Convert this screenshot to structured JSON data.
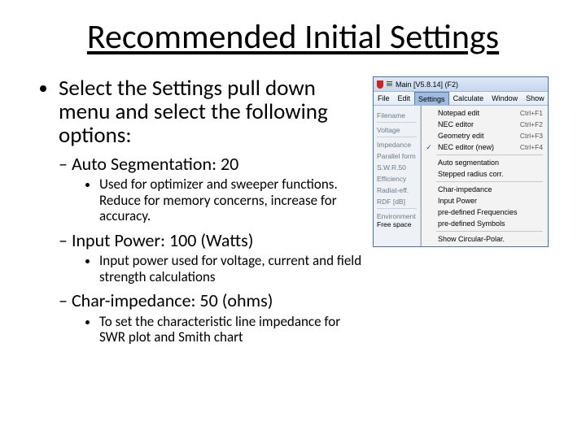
{
  "title": "Recommended Initial Settings",
  "bullet1": "Select the Settings pull down menu and select the following options:",
  "sub1": "Auto Segmentation: 20",
  "sub1_detail": "Used for optimizer and sweeper functions. Reduce for memory concerns, increase for accuracy.",
  "sub2": "Input Power: 100 (Watts)",
  "sub2_detail": "Input power used for voltage, current and field strength calculations",
  "sub3": "Char-impedance: 50 (ohms)",
  "sub3_detail": "To set the characteristic line impedance for SWR plot and Smith chart",
  "app": {
    "title": "Main [V5.8.14] (F2)",
    "menu": {
      "file": "File",
      "edit": "Edit",
      "settings": "Settings",
      "calculate": "Calculate",
      "window": "Window",
      "show": "Show"
    },
    "side": {
      "filename_hdr": "Filename",
      "filename_val": "",
      "voltage_hdr": "Voltage",
      "impedance_hdr": "Impedance",
      "parallel_hdr": "Parallel form",
      "swr_hdr": "S.W.R.50",
      "efficiency_hdr": "Efficiency",
      "radiat_hdr": "Radiat-eff.",
      "rdf_hdr": "RDF [dB]",
      "env_hdr": "Environment",
      "env_val": "Free space"
    },
    "dropdown": {
      "notepad": "Notepad edit",
      "notepad_sc": "Ctrl+F1",
      "nec": "NEC editor",
      "nec_sc": "Ctrl+F2",
      "geom": "Geometry edit",
      "geom_sc": "Ctrl+F3",
      "necnew": "NEC editor (new)",
      "necnew_sc": "Ctrl+F4",
      "autoseg": "Auto segmentation",
      "stepped": "Stepped radius corr.",
      "charimp": "Char-impedance",
      "inputpw": "Input Power",
      "predeffreq": "pre-defined Frequencies",
      "predefsym": "pre-defined Symbols",
      "circpolar": "Show Circular-Polar."
    }
  }
}
